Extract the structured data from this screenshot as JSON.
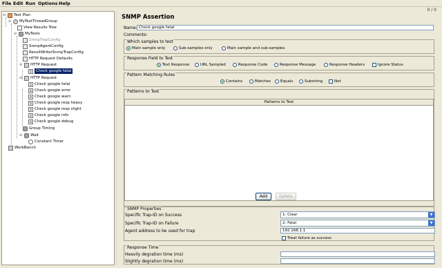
{
  "menu": {
    "file": "File",
    "edit": "Edit",
    "run": "Run",
    "options": "Options",
    "help": "Help"
  },
  "status_counter": "0 / 0",
  "tree": [
    {
      "label": "Test Plan",
      "icon": "test-plan-icon"
    },
    {
      "label": "MyTestThreadGroup",
      "icon": "thread-group-icon"
    },
    {
      "label": "View Results Tree",
      "icon": "listener-icon"
    },
    {
      "label": "MyTests",
      "icon": "controller-icon"
    },
    {
      "label": "SnmpTrapConfig",
      "icon": "config-icon"
    },
    {
      "label": "SnmpAgentConfig",
      "icon": "config-icon"
    },
    {
      "label": "ResultWriterSnmpTrapConfig",
      "icon": "config-icon"
    },
    {
      "label": "HTTP Request Defaults",
      "icon": "config-icon"
    },
    {
      "label": "HTTP Request",
      "icon": "sampler-icon"
    },
    {
      "label": "Check google fatal",
      "icon": "assertion-icon"
    },
    {
      "label": "HTTP Request",
      "icon": "sampler-icon"
    },
    {
      "label": "Check google fatal",
      "icon": "assertion-icon"
    },
    {
      "label": "Check google error",
      "icon": "assertion-icon"
    },
    {
      "label": "Check google warn",
      "icon": "assertion-icon"
    },
    {
      "label": "Check google resp heavy",
      "icon": "assertion-icon"
    },
    {
      "label": "Check google resp slight",
      "icon": "assertion-icon"
    },
    {
      "label": "Check google info",
      "icon": "assertion-icon"
    },
    {
      "label": "Check google debug",
      "icon": "assertion-icon"
    },
    {
      "label": "Group Timing",
      "icon": "controller-icon"
    },
    {
      "label": "Wait",
      "icon": "controller-icon"
    },
    {
      "label": "Constant Timer",
      "icon": "timer-icon"
    },
    {
      "label": "WorkBench",
      "icon": "workbench-icon"
    }
  ],
  "panel": {
    "title": "SNMP Assertion",
    "name_label": "Name:",
    "name_value": "Check google fatal",
    "comments_label": "Comments:",
    "which_samples": {
      "title": "Which samples to test",
      "options": [
        "Main sample only",
        "Sub-samples only",
        "Main sample and sub-samples"
      ],
      "selected": 0
    },
    "response_field": {
      "title": "Response Field to Test",
      "options": [
        "Text Response",
        "URL Sampled",
        "Response Code",
        "Response Message",
        "Response Headers"
      ],
      "selected": 0,
      "ignore_status": "Ignore Status"
    },
    "pattern_rules": {
      "title": "Pattern Matching Rules",
      "options": [
        "Contains",
        "Matches",
        "Equals",
        "Substring"
      ],
      "selected": 0,
      "not_label": "Not"
    },
    "patterns": {
      "title": "Patterns to Test",
      "column": "Patterns to Test",
      "add": "Add",
      "delete": "Delete"
    },
    "snmp": {
      "title": "SNMP Properties",
      "success_label": "Specific Trap-ID on Success",
      "success_value": "1: Clear",
      "failure_label": "Specific Trap-ID on Failure",
      "failure_value": "2: Fatal",
      "agent_label": "Agent address to be used for trap",
      "agent_value": "192.168.1.1",
      "treat_failure": "Treat failure as success"
    },
    "response_time": {
      "title": "Response Time",
      "heavy_label": "Heavily degration time (ms)",
      "heavy_value": "",
      "slight_label": "Slightly degration time (ms)",
      "slight_value": ""
    }
  },
  "colors": {
    "selection": "#0a246a",
    "window_bg": "#ece9d8"
  }
}
